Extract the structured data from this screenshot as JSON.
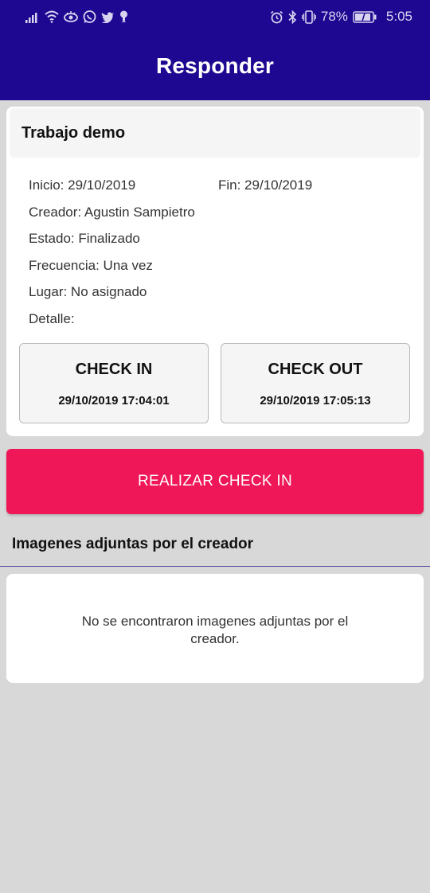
{
  "status_bar": {
    "battery": "78%",
    "time": "5:05",
    "icons_left": [
      "signal-icon",
      "wifi-icon",
      "eye-icon",
      "whatsapp-icon",
      "twitter-icon",
      "notification-icon"
    ],
    "icons_right": [
      "alarm-icon",
      "bluetooth-icon",
      "vibrate-icon",
      "battery-icon"
    ]
  },
  "app_bar": {
    "title": "Responder"
  },
  "job": {
    "title": "Trabajo demo",
    "start": "Inicio: 29/10/2019",
    "end": "Fin: 29/10/2019",
    "creator": "Creador: Agustin Sampietro",
    "status": "Estado: Finalizado",
    "frequency": "Frecuencia: Una vez",
    "place": "Lugar: No asignado",
    "detail": "Detalle:"
  },
  "check_in": {
    "label": "CHECK IN",
    "time": "29/10/2019 17:04:01"
  },
  "check_out": {
    "label": "CHECK OUT",
    "time": "29/10/2019 17:05:13"
  },
  "action": {
    "label": "REALIZAR CHECK IN"
  },
  "images": {
    "title": "Imagenes adjuntas por el creador",
    "empty": "No se encontraron imagenes adjuntas por el creador."
  },
  "colors": {
    "primary": "#1e0891",
    "accent": "#ef1757",
    "background": "#d8d8d8"
  }
}
